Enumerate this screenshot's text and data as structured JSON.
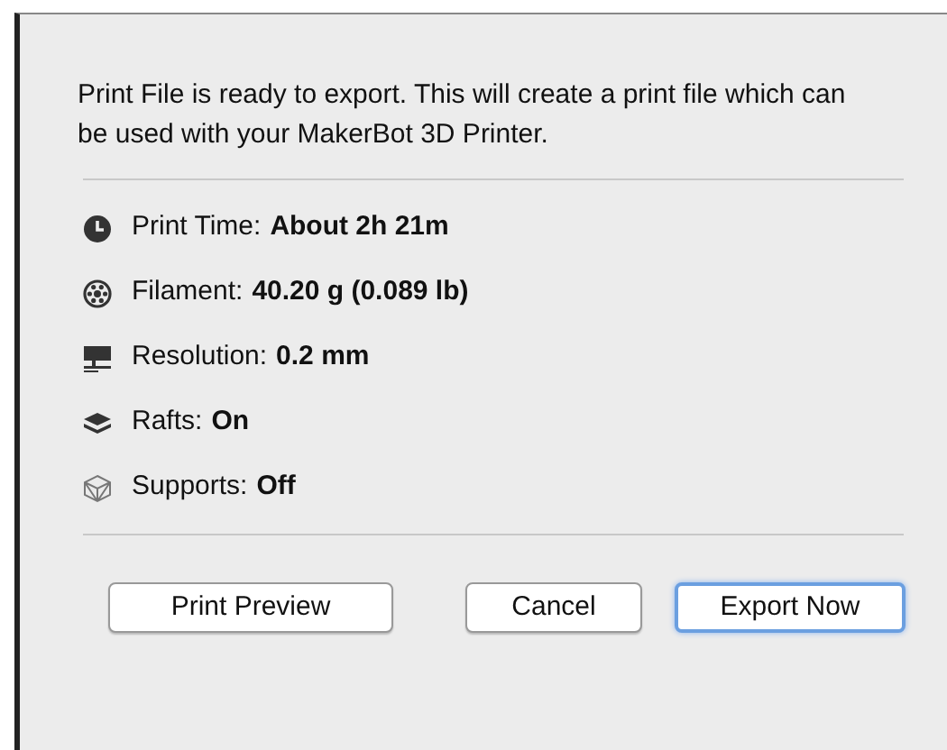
{
  "message": "Print File is ready to export. This will create a print file which can be used with your MakerBot 3D Printer.",
  "details": [
    {
      "kind": "time",
      "label": "Print Time:",
      "value": "About 2h 21m"
    },
    {
      "kind": "filament",
      "label": "Filament:",
      "value": "40.20 g (0.089 lb)"
    },
    {
      "kind": "resolution",
      "label": "Resolution:",
      "value": "0.2 mm"
    },
    {
      "kind": "rafts",
      "label": "Rafts:",
      "value": "On"
    },
    {
      "kind": "supports",
      "label": "Supports:",
      "value": "Off"
    }
  ],
  "buttons": [
    {
      "label": "Print Preview",
      "default": false
    },
    {
      "label": "Cancel",
      "default": false
    },
    {
      "label": "Export Now",
      "default": true
    }
  ]
}
